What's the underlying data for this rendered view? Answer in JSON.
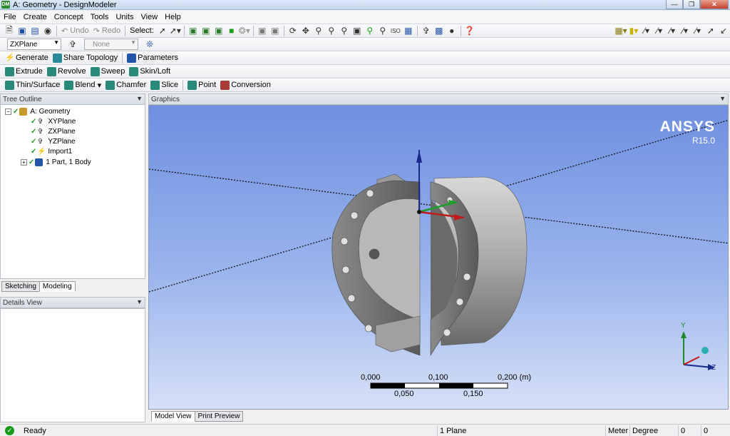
{
  "window": {
    "title": "A: Geometry - DesignModeler",
    "app_badge": "DM"
  },
  "menu": [
    "File",
    "Create",
    "Concept",
    "Tools",
    "Units",
    "View",
    "Help"
  ],
  "toolbar1": {
    "undo": "Undo",
    "redo": "Redo",
    "select_label": "Select:"
  },
  "toolbar2": {
    "plane": "ZXPlane",
    "sketch": "None"
  },
  "toolbar3": {
    "generate": "Generate",
    "share_topology": "Share Topology",
    "parameters": "Parameters"
  },
  "toolbar4": {
    "extrude": "Extrude",
    "revolve": "Revolve",
    "sweep": "Sweep",
    "skin_loft": "Skin/Loft"
  },
  "toolbar5": {
    "thin_surface": "Thin/Surface",
    "blend": "Blend",
    "chamfer": "Chamfer",
    "slice": "Slice",
    "point": "Point",
    "conversion": "Conversion"
  },
  "tree": {
    "title": "Tree Outline",
    "root": "A: Geometry",
    "items": [
      "XYPlane",
      "ZXPlane",
      "YZPlane",
      "Import1",
      "1 Part, 1 Body"
    ]
  },
  "tree_tabs": [
    "Sketching",
    "Modeling"
  ],
  "details": {
    "title": "Details View"
  },
  "graphics": {
    "title": "Graphics",
    "brand": "ANSYS",
    "version": "R15.0",
    "scale_top": [
      "0,000",
      "0,100",
      "0,200 (m)"
    ],
    "scale_bottom": [
      "0,050",
      "0,150"
    ],
    "triad": {
      "y": "Y",
      "z": "Z"
    }
  },
  "view_tabs": [
    "Model View",
    "Print Preview"
  ],
  "status": {
    "ready": "Ready",
    "selection": "1 Plane",
    "unit_length": "Meter",
    "unit_angle": "Degree",
    "val1": "0",
    "val2": "0"
  },
  "colors": {
    "accent_green": "#1a9a1a",
    "graphics_top": "#6f8fe0",
    "graphics_bottom": "#d6e0f7"
  }
}
